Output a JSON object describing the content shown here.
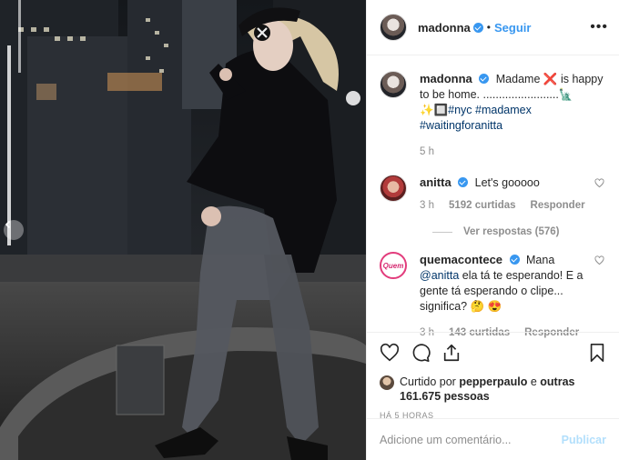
{
  "post": {
    "author": "madonna",
    "follow_label": "Seguir",
    "more_label": "•••"
  },
  "caption": {
    "username": "madonna",
    "text_before": "Madame",
    "flag_icon": "❌",
    "text_after": "is happy to be home. ........................",
    "emojis": "🗽 ✨🔲",
    "hashtag_nyc": "#nyc",
    "hashtag_madamex": "#madamex",
    "hashtag_waiting": "#waitingforanitta",
    "time": "5 h"
  },
  "comments": [
    {
      "username": "anitta",
      "text": "Let's gooooo",
      "time": "3 h",
      "likes": "5192 curtidas",
      "reply_label": "Responder",
      "view_replies": "Ver respostas (576)"
    },
    {
      "username": "quemacontece",
      "avatar_text": "Quem",
      "text_pre": "Mana",
      "mention": "@anitta",
      "text_post": "ela tá te esperando! E a gente tá esperando o clipe... significa? 🤔 😍",
      "time": "3 h",
      "likes": "143 curtidas",
      "reply_label": "Responder"
    }
  ],
  "likes_line": {
    "liked_by_label": "Curtido por",
    "liked_by_user": "pepperpaulo",
    "and_label": "e",
    "others": "outras 161.675 pessoas"
  },
  "timestamp": "HÁ 5 HORAS",
  "add_comment": {
    "placeholder": "Adicione um comentário...",
    "publish_label": "Publicar"
  },
  "colors": {
    "accent": "#3897f0",
    "link": "#003569",
    "muted": "#8e8e8e",
    "publish_disabled": "#b2dffc"
  }
}
